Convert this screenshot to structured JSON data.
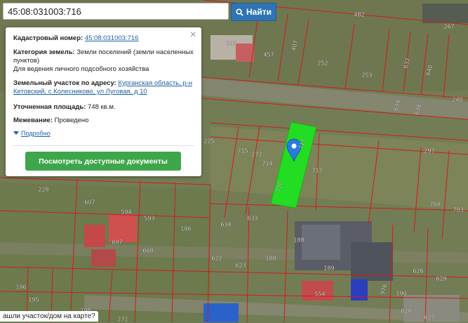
{
  "search": {
    "value": "45:08:031003:716",
    "button_label": "Найти"
  },
  "panel": {
    "cadastral_label": "Кадастровый номер:",
    "cadastral_value": "45:08:031003:716",
    "category_label": "Категория земель:",
    "category_value": "Земли поселений (земли населенных пунктов)",
    "usage_value": "Для ведения личного подсобного хозяйства",
    "address_label": "Земельный участок по адресу:",
    "address_value": "Курганская область, р-н Кетовский, с Колесниково, ул Луговая, д 10",
    "area_label": "Уточненная площадь:",
    "area_value": "748 кв.м.",
    "survey_label": "Межевание:",
    "survey_value": "Проведено",
    "details_link": "Подробно",
    "docs_button": "Посмотреть доступные документы"
  },
  "bottom_prompt": "ашли участок/дом на карте?",
  "map_labels": [
    "482",
    "267",
    "300",
    "457",
    "407",
    "252",
    "253",
    "637",
    "640",
    "240",
    "639",
    "638",
    "225",
    "715",
    "272",
    "714",
    "717",
    "297",
    "228",
    "607",
    "594",
    "593",
    "186",
    "634",
    "633",
    "717",
    "704",
    "703",
    "697",
    "668",
    "188",
    "622",
    "623",
    "188",
    "189",
    "626",
    "629",
    "196",
    "195",
    "198",
    "554",
    "976",
    "190",
    "628",
    "627",
    "271",
    "720"
  ],
  "colors": {
    "selected_plot": "#22dd22",
    "cadastral_lines": "#d21b1b",
    "search_button": "#2f75b5",
    "docs_button": "#3ea64a"
  }
}
